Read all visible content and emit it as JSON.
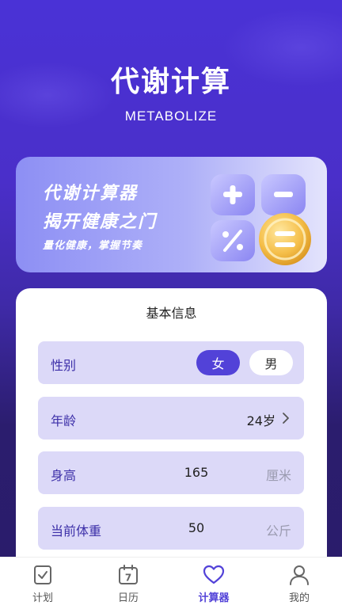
{
  "header": {
    "title": "代谢计算",
    "subtitle": "METABOLIZE"
  },
  "banner": {
    "line1": "代谢计算器",
    "line2": "揭开健康之门",
    "line3": "量化健康，掌握节奏"
  },
  "basic_info": {
    "title": "基本信息",
    "gender": {
      "label": "性别",
      "options": [
        "女",
        "男"
      ],
      "selected": "女"
    },
    "age": {
      "label": "年龄",
      "value": "24岁"
    },
    "height": {
      "label": "身高",
      "value": "165",
      "unit": "厘米"
    },
    "weight": {
      "label": "当前体重",
      "value": "50",
      "unit": "公斤"
    }
  },
  "tabbar": {
    "items": [
      {
        "label": "计划",
        "icon": "plan-icon"
      },
      {
        "label": "日历",
        "icon": "calendar-icon",
        "badge": "7"
      },
      {
        "label": "计算器",
        "icon": "heart-icon",
        "active": true
      },
      {
        "label": "我的",
        "icon": "user-icon"
      }
    ]
  },
  "colors": {
    "accent": "#5242d8",
    "row_bg": "#dcd9f8",
    "bg_top": "#4a32d6",
    "bg_bottom": "#2a1c6a"
  }
}
